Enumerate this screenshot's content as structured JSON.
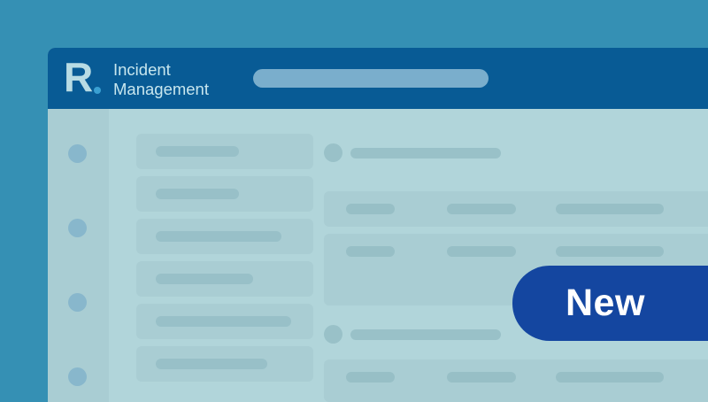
{
  "header": {
    "logo_letter": "R",
    "title_line1": "Incident",
    "title_line2": "Management",
    "search": {
      "value": "",
      "placeholder": ""
    }
  },
  "badge": {
    "label": "New"
  },
  "colors": {
    "background": "#3590b4",
    "header": "#085b95",
    "content": "#b1d5da",
    "badge": "#1446a0",
    "logo_accent": "#3aa0d2"
  }
}
